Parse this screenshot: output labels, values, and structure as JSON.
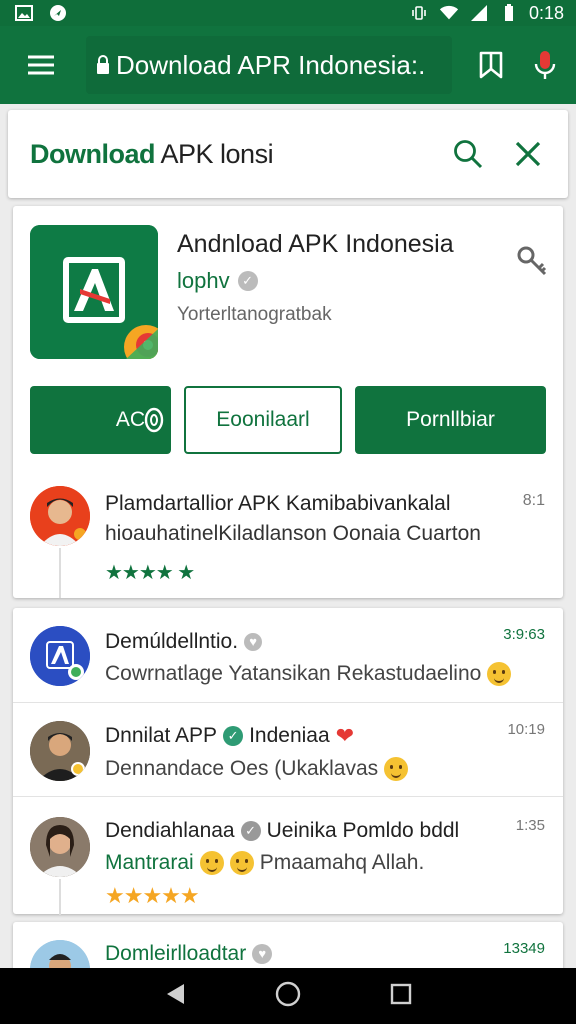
{
  "status": {
    "time": "0:18"
  },
  "toolbar": {
    "url": "Download APR Indonesia:."
  },
  "search": {
    "bold": "Download",
    "rest": " APK lonsi"
  },
  "app": {
    "title": "Andnload APK Indonesia",
    "developer": "lophv",
    "subtitle": "Yorterltanogratbak",
    "buttons": [
      "AC",
      "Eoonilaarl",
      "Pornllbiar"
    ]
  },
  "review": {
    "title": "Plamdartallior APK Kamibabivankalal",
    "text": "hioauhatinelKiladlanson Oonaia Cuarton",
    "time": "8:1",
    "stars": "★★★★ ★"
  },
  "messages": [
    {
      "name": "Demúldellntio.",
      "msg": "Cowrnatlage Yatansikan Rekastudaelino",
      "time": "3:9:63"
    },
    {
      "name": "Dnnilat APP",
      "name2": "Indeniaa",
      "msg": "Dennandace Oes (Ukaklavas",
      "time": "10:19"
    },
    {
      "name": "Dendiahlanaa",
      "name2": "Ueinika Pomldo bddl",
      "msg": "Mantrarai",
      "msg2": "Pmaamahq Allah.",
      "stars": "★★★★★",
      "time": "1:35"
    }
  ],
  "bottom": {
    "name": "Domleirlloadtar",
    "time": "13349"
  },
  "colors": {
    "brand": "#10733e",
    "statusbar": "#0f6e3a"
  }
}
